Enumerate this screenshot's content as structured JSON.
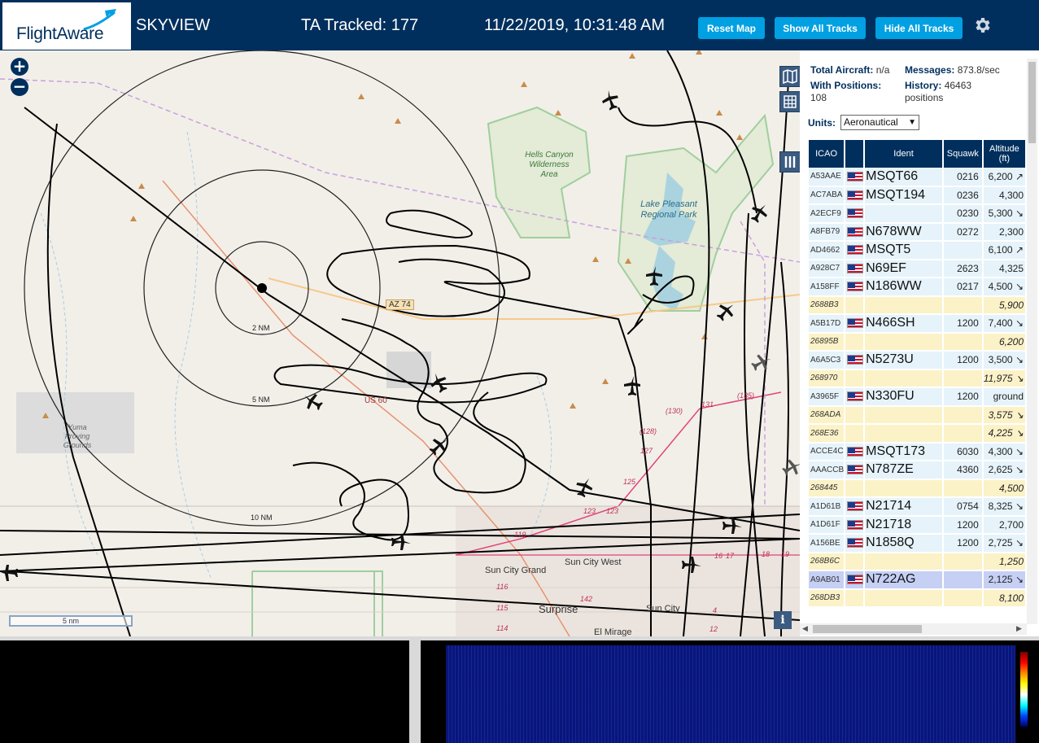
{
  "header": {
    "logo_text": "FlightAware",
    "app_title": "SKYVIEW",
    "tracked_text": "TA Tracked: 177",
    "datetime": "11/22/2019, 10:31:48 AM",
    "buttons": {
      "reset": "Reset Map",
      "show_all": "Show All Tracks",
      "hide_all": "Hide All Tracks"
    },
    "settings_icon": "gear-icon"
  },
  "map": {
    "zoom_in": "+",
    "zoom_out": "−",
    "range_rings": [
      "2 NM",
      "5 NM",
      "10 NM"
    ],
    "labels": [
      "Hells Canyon Wilderness Area",
      "Lake Pleasant Regional Park",
      "AZ 74",
      "US 60",
      "Yuma Proving Grounds",
      "Sun City Grand",
      "Sun City West",
      "Surprise",
      "Sun City",
      "El Mirage"
    ],
    "road_numbers": [
      "(130)",
      "131",
      "(135)",
      "(128)",
      "127",
      "125",
      "123",
      "123",
      "119",
      "116",
      "115",
      "114",
      "142",
      "17",
      "16",
      "18",
      "19",
      "4",
      "12"
    ],
    "scale_text": "5 nm",
    "info_label": "i",
    "tool_icons": [
      "map-layers-icon",
      "grid-icon",
      "columns-icon"
    ]
  },
  "panel": {
    "total_aircraft_label": "Total Aircraft:",
    "total_aircraft_value": "n/a",
    "messages_label": "Messages:",
    "messages_value": "873.8/sec",
    "with_positions_label": "With Positions:",
    "with_positions_value": "108",
    "history_label": "History:",
    "history_value": "46463",
    "history_unit": "positions",
    "units_label": "Units:",
    "units_value": "Aeronautical",
    "columns": [
      "ICAO",
      "",
      "Ident",
      "Squawk",
      "Altitude (ft)"
    ],
    "rows": [
      {
        "icao": "A53AAE",
        "flag": true,
        "ident": "MSQT66",
        "squawk": "0216",
        "alt": "6,200 ↗",
        "kind": "norm"
      },
      {
        "icao": "AC7ABA",
        "flag": true,
        "ident": "MSQT194",
        "squawk": "0236",
        "alt": "4,300",
        "kind": "norm"
      },
      {
        "icao": "A2ECF9",
        "flag": true,
        "ident": "",
        "squawk": "0230",
        "alt": "5,300 ↘",
        "kind": "norm"
      },
      {
        "icao": "A8FB79",
        "flag": true,
        "ident": "N678WW",
        "squawk": "0272",
        "alt": "2,300",
        "kind": "norm"
      },
      {
        "icao": "AD4662",
        "flag": true,
        "ident": "MSQT5",
        "squawk": "",
        "alt": "6,100 ↗",
        "kind": "norm"
      },
      {
        "icao": "A928C7",
        "flag": true,
        "ident": "N69EF",
        "squawk": "2623",
        "alt": "4,325",
        "kind": "norm"
      },
      {
        "icao": "A158FF",
        "flag": true,
        "ident": "N186WW",
        "squawk": "0217",
        "alt": "4,500 ↘",
        "kind": "norm"
      },
      {
        "icao": "2688B3",
        "flag": false,
        "ident": "",
        "squawk": "",
        "alt": "5,900",
        "kind": "mlat"
      },
      {
        "icao": "A5B17D",
        "flag": true,
        "ident": "N466SH",
        "squawk": "1200",
        "alt": "7,400 ↘",
        "kind": "norm"
      },
      {
        "icao": "26895B",
        "flag": false,
        "ident": "",
        "squawk": "",
        "alt": "6,200",
        "kind": "mlat"
      },
      {
        "icao": "A6A5C3",
        "flag": true,
        "ident": "N5273U",
        "squawk": "1200",
        "alt": "3,500 ↘",
        "kind": "norm"
      },
      {
        "icao": "268970",
        "flag": false,
        "ident": "",
        "squawk": "",
        "alt": "11,975 ↘",
        "kind": "mlat"
      },
      {
        "icao": "A3965F",
        "flag": true,
        "ident": "N330FU",
        "squawk": "1200",
        "alt": "ground",
        "kind": "norm"
      },
      {
        "icao": "268ADA",
        "flag": false,
        "ident": "",
        "squawk": "",
        "alt": "3,575 ↘",
        "kind": "mlat"
      },
      {
        "icao": "268E36",
        "flag": false,
        "ident": "",
        "squawk": "",
        "alt": "4,225 ↘",
        "kind": "mlat"
      },
      {
        "icao": "ACCE4C",
        "flag": true,
        "ident": "MSQT173",
        "squawk": "6030",
        "alt": "4,300 ↘",
        "kind": "norm"
      },
      {
        "icao": "AAACCB",
        "flag": true,
        "ident": "N787ZE",
        "squawk": "4360",
        "alt": "2,625 ↘",
        "kind": "norm"
      },
      {
        "icao": "268445",
        "flag": false,
        "ident": "",
        "squawk": "",
        "alt": "4,500",
        "kind": "mlat"
      },
      {
        "icao": "A1D61B",
        "flag": true,
        "ident": "N21714",
        "squawk": "0754",
        "alt": "8,325 ↘",
        "kind": "norm"
      },
      {
        "icao": "A1D61F",
        "flag": true,
        "ident": "N21718",
        "squawk": "1200",
        "alt": "2,700",
        "kind": "norm"
      },
      {
        "icao": "A156BE",
        "flag": true,
        "ident": "N1858Q",
        "squawk": "1200",
        "alt": "2,725 ↘",
        "kind": "norm"
      },
      {
        "icao": "268B6C",
        "flag": false,
        "ident": "",
        "squawk": "",
        "alt": "1,250",
        "kind": "mlat"
      },
      {
        "icao": "A9AB01",
        "flag": true,
        "ident": "N722AG",
        "squawk": "",
        "alt": "2,125 ↘",
        "kind": "sel"
      },
      {
        "icao": "268DB3",
        "flag": false,
        "ident": "",
        "squawk": "",
        "alt": "8,100",
        "kind": "mlat"
      }
    ]
  },
  "colors": {
    "header_bg": "#002f5d",
    "button_bg": "#00a0e2",
    "row_adsb": "#e6f3fa",
    "row_mlat": "#fcf2c8",
    "row_selected": "#c6d0f5"
  }
}
